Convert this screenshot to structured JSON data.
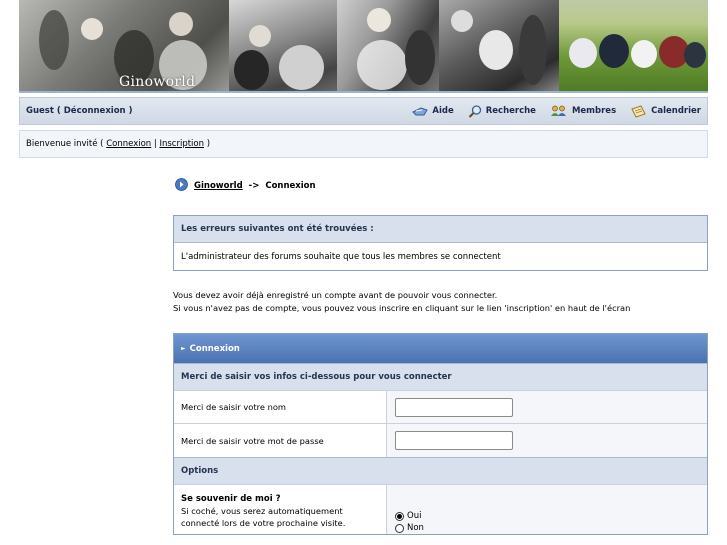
{
  "banner": {
    "title": "Ginoworld"
  },
  "navbar": {
    "guest_name": "Guest",
    "paren_open": "(",
    "logout_label": "Déconnexion",
    "paren_close": ")",
    "links": [
      {
        "label": "Aide",
        "icon": "help-icon"
      },
      {
        "label": "Recherche",
        "icon": "search-icon"
      },
      {
        "label": "Membres",
        "icon": "members-icon"
      },
      {
        "label": "Calendrier",
        "icon": "calendar-icon"
      }
    ]
  },
  "welcome": {
    "prefix": "Bienvenue invité (",
    "login_link": "Connexion",
    "separator": "|",
    "register_link": "Inscription",
    "suffix": ")"
  },
  "breadcrumb": {
    "home": "Ginoworld",
    "separator": "->",
    "current": "Connexion"
  },
  "errors": {
    "header": "Les erreurs suivantes ont été trouvées :",
    "message": "L'administrateur des forums souhaite que tous les membres se connectent"
  },
  "intro": {
    "line1": "Vous devez avoir déjà enregistré un compte avant de pouvoir vous connecter.",
    "line2": "Si vous n'avez pas de compte, vous pouvez vous inscrire en cliquant sur le lien 'inscription' en haut de l'écran"
  },
  "login": {
    "header": "Connexion",
    "subheader": "Merci de saisir vos infos ci-dessous pour vous connecter",
    "username_label": "Merci de saisir votre nom",
    "username_value": "",
    "password_label": "Merci de saisir votre mot de passe",
    "password_value": "",
    "options_header": "Options",
    "remember_title": "Se souvenir de moi ?",
    "remember_desc": "Si coché, vous serez automatiquement connecté lors de votre prochaine visite.",
    "remember_yes": "Oui",
    "remember_no": "Non",
    "remember_selected": "Oui"
  }
}
